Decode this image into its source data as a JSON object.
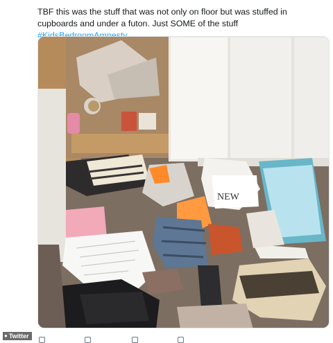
{
  "tweet": {
    "text_plain": "TBF this was the stuff that was not only on floor but was stuffed in cupboards and under a futon. Just SOME of the stuff ",
    "hashtag": "#KidsBedroomAmnesty"
  },
  "photo": {
    "icon": "bedroom-mess-photo"
  },
  "credit": {
    "label": "Twitter",
    "icon": "camera-icon"
  },
  "actions": [
    "reply-icon",
    "retweet-icon",
    "like-icon",
    "share-icon"
  ],
  "colors": {
    "hashtag": "#1da1f2",
    "text": "#14171a",
    "action_icon": "#657786"
  }
}
